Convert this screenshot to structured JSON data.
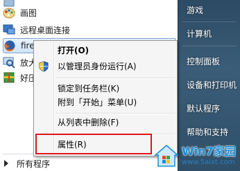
{
  "start_menu": {
    "programs": [
      {
        "label": "画图",
        "icon": "paint-icon"
      },
      {
        "label": "远程桌面连接",
        "icon": "remote-desktop-icon"
      },
      {
        "label": "fire",
        "icon": "firefox-icon",
        "selected": true
      },
      {
        "label": "放大",
        "icon": "magnifier-icon"
      },
      {
        "label": "好压",
        "icon": "haozip-icon"
      }
    ],
    "all_programs_label": "所有程序"
  },
  "right_pane": {
    "items": [
      "游戏",
      "计算机",
      "控制面板",
      "设备和打印机",
      "默认程序",
      "帮助和支持"
    ]
  },
  "context_menu": {
    "items": [
      {
        "label": "打开(O)",
        "bold": true
      },
      {
        "label": "以管理员身份运行(A)",
        "icon": "uac-shield-icon"
      },
      {
        "label": "锁定到任务栏(K)"
      },
      {
        "label": "附到「开始」菜单(U)"
      },
      {
        "label": "从列表中删除(F)"
      },
      {
        "label": "属性(R)",
        "highlighted": true
      }
    ]
  },
  "watermark": {
    "title": "Win7家园",
    "url": "www.5aixt.com"
  },
  "colors": {
    "highlight_box": "#e0141c",
    "right_pane": "#35566f",
    "watermark_blue": "#1a8fd6"
  }
}
